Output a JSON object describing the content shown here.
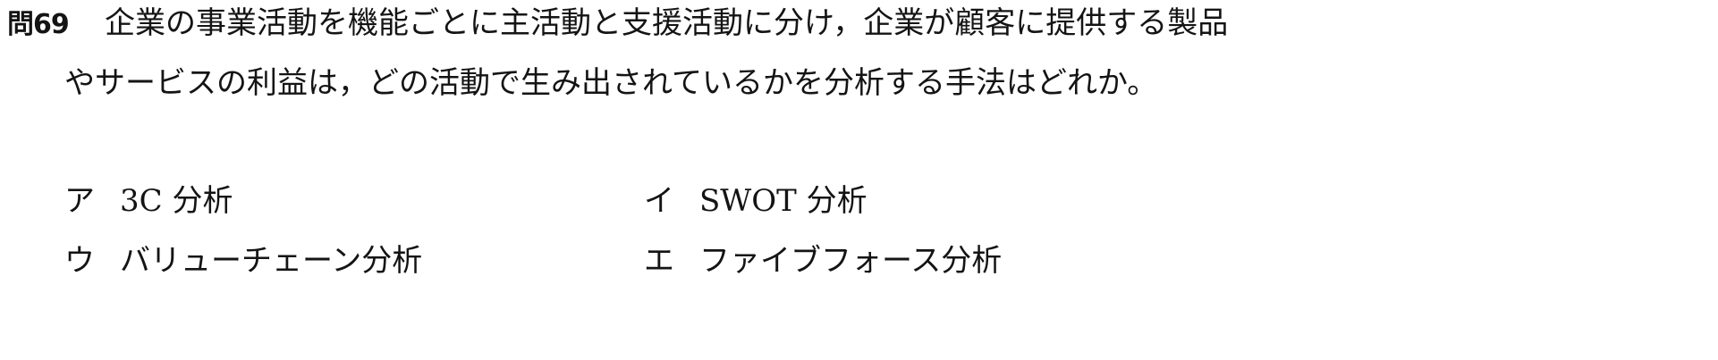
{
  "question": {
    "number": "問69",
    "line1": "企業の事業活動を機能ごとに主活動と支援活動に分け，企業が顧客に提供する製品",
    "line2": "やサービスの利益は，どの活動で生み出されているかを分析する手法はどれか。"
  },
  "choices": [
    {
      "mark": "ア",
      "text": "3C 分析"
    },
    {
      "mark": "イ",
      "text": "SWOT 分析"
    },
    {
      "mark": "ウ",
      "text": "バリューチェーン分析"
    },
    {
      "mark": "エ",
      "text": "ファイブフォース分析"
    }
  ]
}
